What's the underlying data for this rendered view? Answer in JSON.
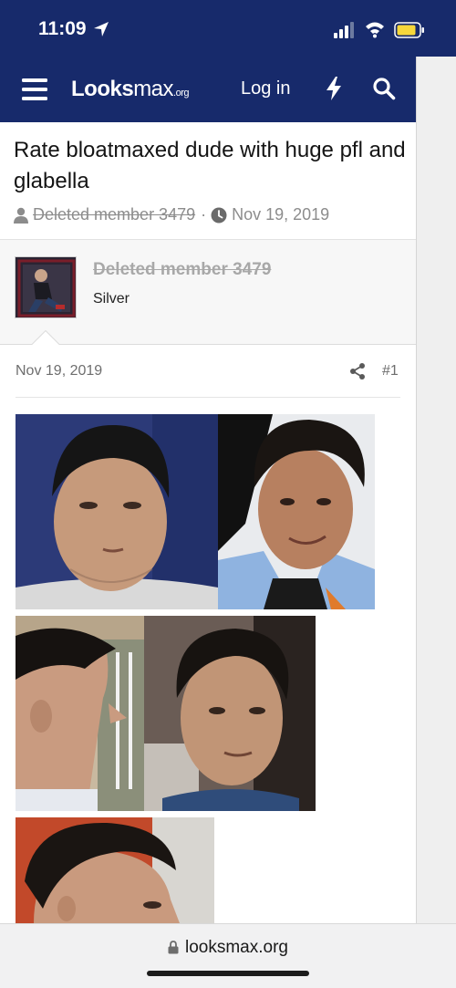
{
  "status_bar": {
    "time": "11:09"
  },
  "nav": {
    "logo_main": "Looks",
    "logo_max": "max",
    "logo_org": ".org",
    "login_label": "Log in"
  },
  "thread": {
    "title": "Rate bloatmaxed dude with huge pfl and glabella",
    "author": "Deleted member 3479",
    "separator": "·",
    "date": "Nov 19, 2019"
  },
  "post": {
    "author_name": "Deleted member 3479",
    "author_rank": "Silver",
    "date": "Nov 19, 2019",
    "number": "#1"
  },
  "browser": {
    "url": "looksmax.org"
  },
  "colors": {
    "brand": "#172a6b",
    "muted": "#8c8c8c",
    "background": "#ffffff"
  }
}
